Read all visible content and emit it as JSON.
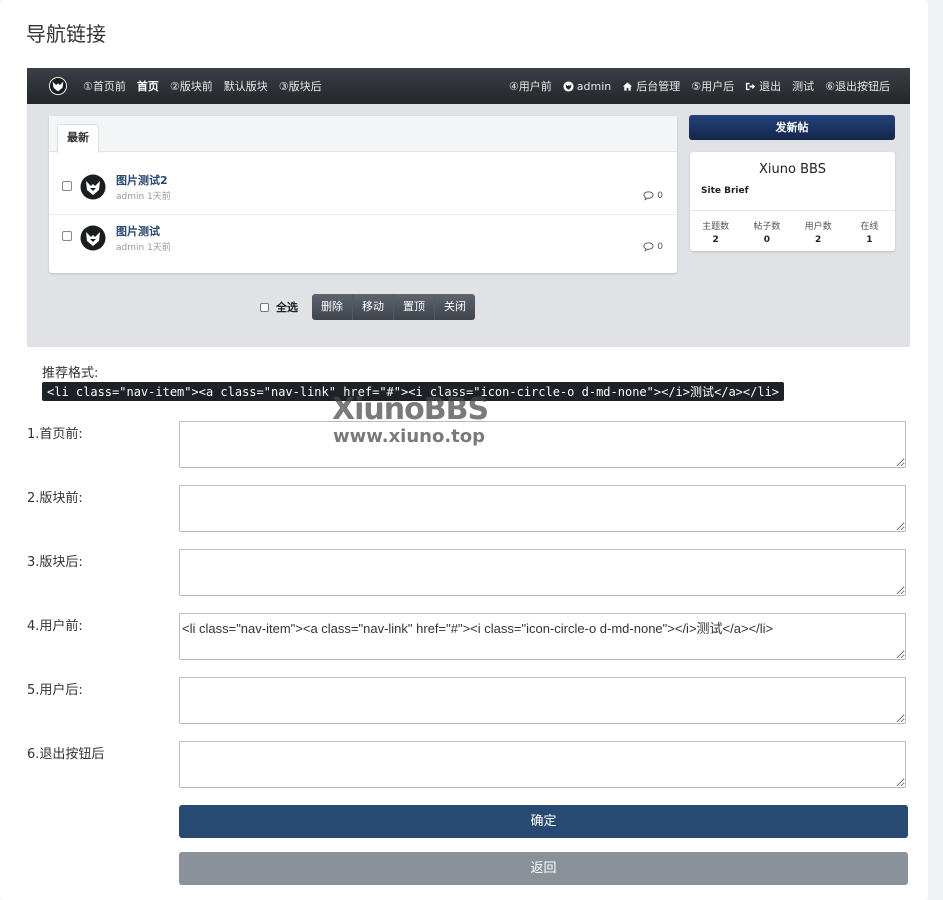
{
  "page": {
    "title": "导航链接"
  },
  "preview": {
    "nav_left": [
      {
        "label": "①首页前",
        "active": false
      },
      {
        "label": "首页",
        "active": true
      },
      {
        "label": "②版块前",
        "active": false
      },
      {
        "label": "默认版块",
        "active": false
      },
      {
        "label": "③版块后",
        "active": false
      }
    ],
    "nav_right": [
      {
        "label": "④用户前"
      },
      {
        "label": "admin",
        "icon": "user-avatar-icon"
      },
      {
        "label": "后台管理",
        "icon": "home-icon"
      },
      {
        "label": "⑤用户后"
      },
      {
        "label": "退出",
        "icon": "sign-out-icon"
      },
      {
        "label": "测试"
      },
      {
        "label": "⑥退出按钮后"
      }
    ],
    "tab_latest": "最新",
    "threads": [
      {
        "title": "图片测试2",
        "author": "admin",
        "time": "1天前",
        "comments": "0"
      },
      {
        "title": "图片测试",
        "author": "admin",
        "time": "1天前",
        "comments": "0"
      }
    ],
    "new_post": "发新帖",
    "site": {
      "name": "Xiuno BBS",
      "brief": "Site Brief",
      "stats": [
        {
          "label": "主题数",
          "value": "2"
        },
        {
          "label": "帖子数",
          "value": "0"
        },
        {
          "label": "用户数",
          "value": "2"
        },
        {
          "label": "在线",
          "value": "1"
        }
      ]
    },
    "mod": {
      "select_all": "全选",
      "buttons": [
        "删除",
        "移动",
        "置顶",
        "关闭"
      ]
    }
  },
  "watermark": {
    "line1": "XiunoBBS",
    "line2": "www.xiuno.top"
  },
  "recommend": {
    "label": "推荐格式:",
    "code": "<li class=\"nav-item\"><a class=\"nav-link\" href=\"#\"><i class=\"icon-circle-o d-md-none\"></i>测试</a></li>"
  },
  "form": {
    "fields": [
      {
        "label": "1.首页前:",
        "value": ""
      },
      {
        "label": "2.版块前:",
        "value": ""
      },
      {
        "label": "3.版块后:",
        "value": ""
      },
      {
        "label": "4.用户前:",
        "value": "<li class=\"nav-item\"><a class=\"nav-link\" href=\"#\"><i class=\"icon-circle-o d-md-none\"></i>测试</a></li>"
      },
      {
        "label": "5.用户后:",
        "value": ""
      },
      {
        "label": "6.退出按钮后",
        "value": ""
      }
    ],
    "submit": "确定",
    "back": "返回"
  },
  "colors": {
    "primary": "#274a72",
    "secondary": "#8a9199",
    "nav_dark": "#2b2e33"
  }
}
